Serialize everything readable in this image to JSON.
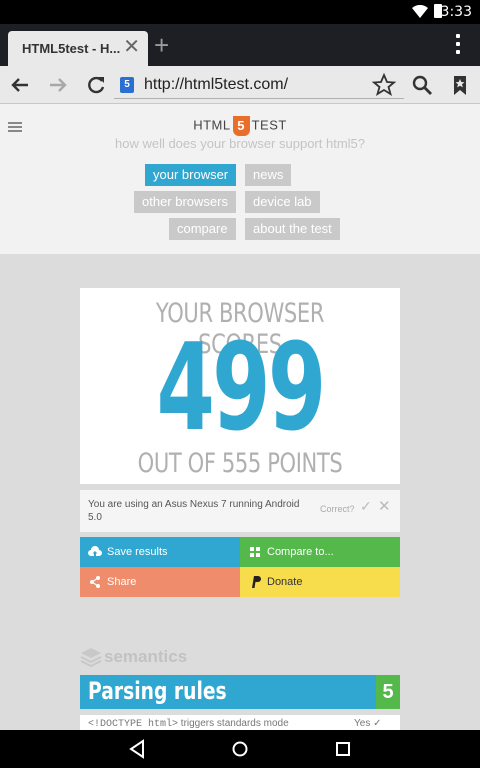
{
  "status": {
    "time": "3:33"
  },
  "tab": {
    "title": "HTML5test - H..."
  },
  "toolbar": {
    "url": "http://html5test.com/",
    "favicon_text": "5"
  },
  "site": {
    "logo_left": "HTML",
    "logo_mark": "5",
    "logo_right": "TEST",
    "tagline": "how well does your browser support html5?",
    "nav": {
      "your_browser": "your browser",
      "news": "news",
      "other_browsers": "other browsers",
      "device_lab": "device lab",
      "compare": "compare",
      "about": "about the test"
    }
  },
  "score": {
    "heading": "YOUR BROWSER SCORES",
    "value": "499",
    "footer": "OUT OF 555 POINTS"
  },
  "device": {
    "text": "You are using an Asus Nexus 7 running Android 5.0",
    "correct_label": "Correct?"
  },
  "actions": {
    "save": "Save results",
    "compare": "Compare to...",
    "share": "Share",
    "donate": "Donate"
  },
  "section": {
    "name": "semantics"
  },
  "parsing": {
    "title": "Parsing rules",
    "score": "5",
    "row1_code": "<!DOCTYPE html>",
    "row1_text": " triggers standards mode",
    "row1_result": "Yes"
  },
  "colors": {
    "accent": "#2fa7d1",
    "green": "#55b84b",
    "share": "#ef8c6b",
    "donate": "#f7dc4b",
    "html5_orange": "#e96d2b"
  }
}
